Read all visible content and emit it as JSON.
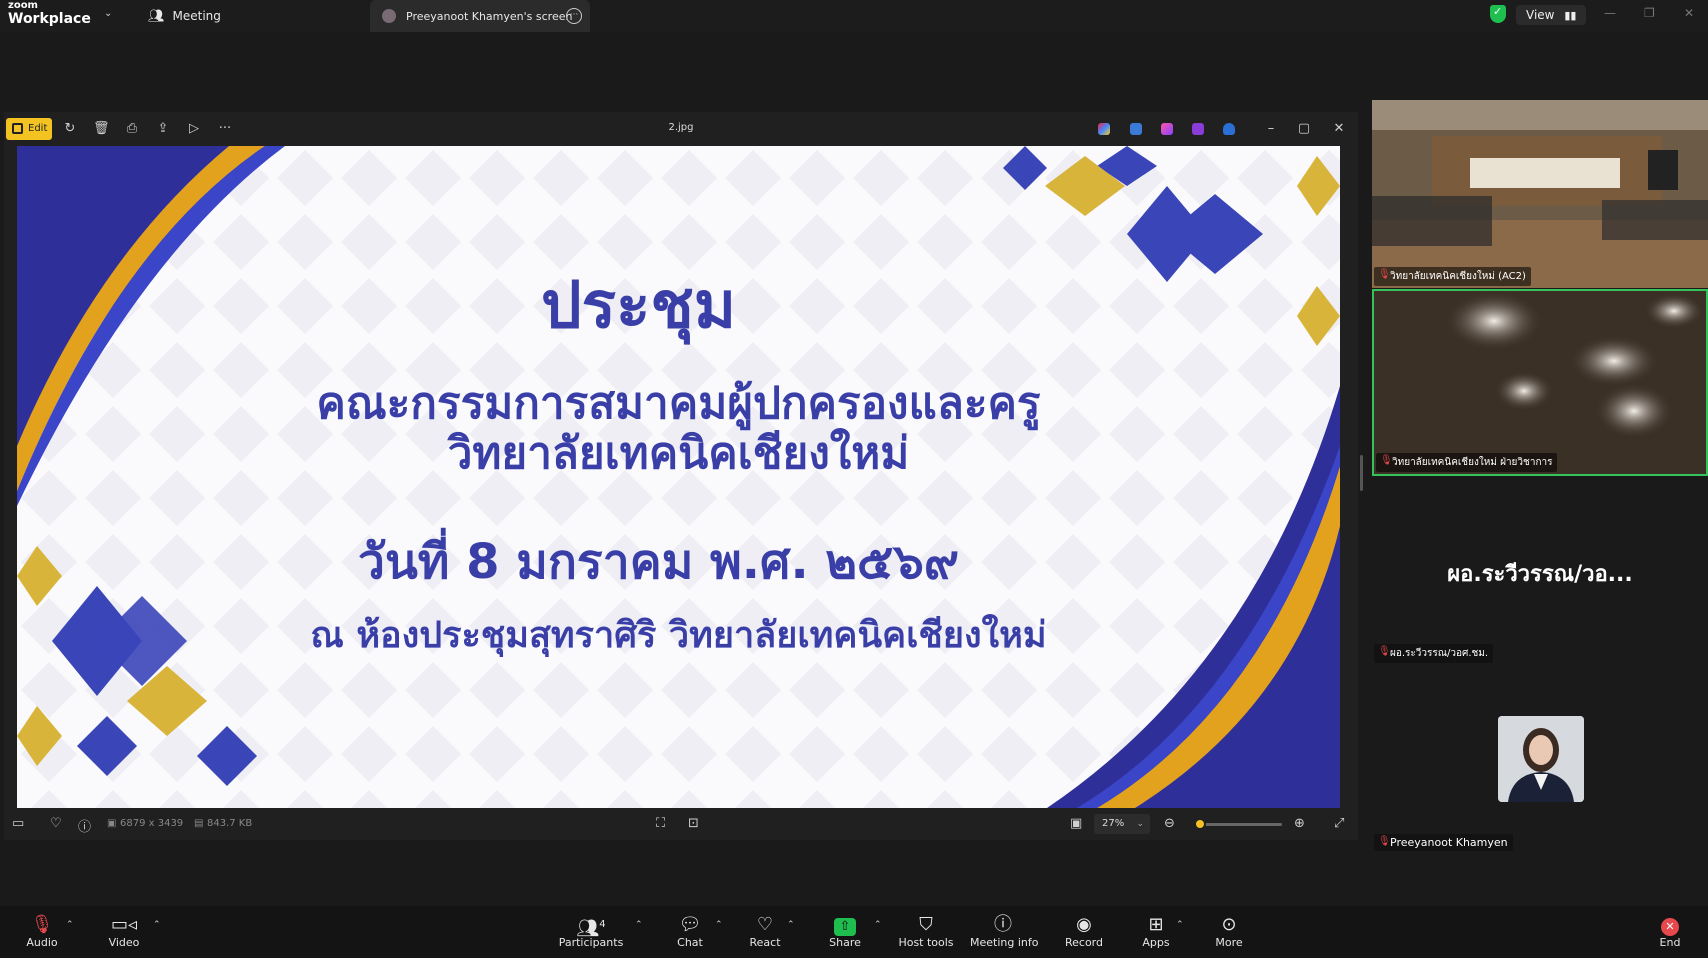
{
  "app": {
    "brand_small": "zoom",
    "brand": "Workplace"
  },
  "tabs": {
    "meeting": "Meeting",
    "screen": "Preeyanoot Khamyen's screen"
  },
  "top_right": {
    "view_label": "View"
  },
  "viewer": {
    "edit_label": "Edit",
    "filename": "2.jpg",
    "dimensions": "6879 x 3439",
    "filesize": "843.7 KB",
    "zoom": "27%",
    "zoom_level": 0.05
  },
  "slide": {
    "title": "ประชุม",
    "line1": "คณะกรรมการสมาคมผู้ปกครองและครู",
    "line2": "วิทยาลัยเทคนิคเชียงใหม่",
    "date": "วันที่ 8 มกราคม พ.ศ. ๒๕๖๙",
    "venue": "ณ ห้องประชุมสุทราศิริ  วิทยาลัยเทคนิคเชียงใหม่"
  },
  "participants": [
    {
      "label": "วิทยาลัยเทคนิคเชียงใหม่ (AC2)"
    },
    {
      "label": "วิทยาลัยเทคนิคเชียงใหม่ ฝ่ายวิชาการ"
    },
    {
      "display_name": "ผอ.ระวีวรรณ/วอ...",
      "label": "ผอ.ระวีวรรณ/วอศ.ชม."
    },
    {
      "label": "Preeyanoot Khamyen"
    }
  ],
  "bottom": {
    "audio": "Audio",
    "video": "Video",
    "participants": "Participants",
    "participants_count": "4",
    "chat": "Chat",
    "react": "React",
    "share": "Share",
    "host_tools": "Host tools",
    "meeting_info": "Meeting info",
    "record": "Record",
    "apps": "Apps",
    "more": "More",
    "end": "End"
  }
}
